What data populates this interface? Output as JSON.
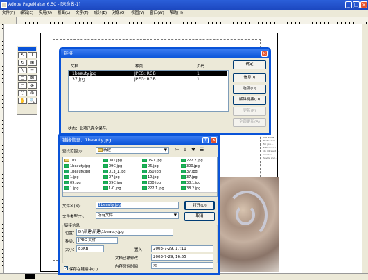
{
  "window": {
    "title": "Adobe PageMaker 6.5C - [未命名-1]",
    "controls": [
      "_",
      "□",
      "×"
    ]
  },
  "menu": [
    "文件(F)",
    "编辑(E)",
    "实用(U)",
    "版面(L)",
    "文字(T)",
    "成分(E)",
    "对象(O)",
    "视图(V)",
    "窗口(W)",
    "帮助(H)"
  ],
  "links_dialog": {
    "title": "链接",
    "columns": [
      "文档",
      "种类",
      "页码"
    ],
    "rows": [
      {
        "doc": "1beauty.jpg",
        "kind": "JPEG: RGB",
        "page": "1"
      },
      {
        "doc": "37.jpg",
        "kind": "JPEG: RGB",
        "page": "1"
      }
    ],
    "buttons": [
      "确定",
      "信息(I)",
      "选项(O)",
      "解除链接(U)",
      "更新(P)",
      "全部更新(A)"
    ],
    "status": "状态：此项已完全保存。"
  },
  "open_dialog": {
    "title": "链接信息：1beauty.jpg",
    "look_in_label": "查找范围(I):",
    "look_in_value": "新建",
    "files": [
      [
        "1bz",
        "081.jpg",
        "05-1.jpg",
        "222.2.jpg"
      ],
      [
        "1beauty.jpg",
        "09C.jpg",
        "06.jpg",
        "300.jpg"
      ],
      [
        "1beauty.jpg",
        "013_1.jpg",
        "050.jpg",
        "37.jpg"
      ],
      [
        "1.jpg",
        "07.jpg",
        "10.jpg",
        "37.jpg"
      ],
      [
        "09.jpg",
        "09C.jpg",
        "200.jpg",
        "38.1.jpg"
      ],
      [
        "1.jpg",
        "1-0.jpg",
        "222.1.jpg",
        "38.2.jpg"
      ]
    ],
    "filename_label": "文件名(N):",
    "filename_value": "1beauty.jpg",
    "filetype_label": "文件类型(T):",
    "filetype_value": "所有文件",
    "open_button": "打开(O)",
    "cancel_button": "取消",
    "info_group": "链接信息",
    "location_label": "位置：",
    "location_value": "D:\\新建\\新建\\1beauty.jpg",
    "kind_label": "种类：",
    "kind_value": "JPEG 文件",
    "size_label": "大小：",
    "size_value": "83KB",
    "placed_label": "置入：",
    "placed_value": "2003-7-29, 17:11",
    "modified_label": "文档已被修改：",
    "modified_value": "2003-7-29, 16:55",
    "original_modified_label": "内存原件时间：",
    "original_modified_value": "无",
    "checkbox_label": "保存在链接中(C)"
  },
  "document_text": "the waves that search for you ... father and I do not want ... reaches Seville and ..."
}
